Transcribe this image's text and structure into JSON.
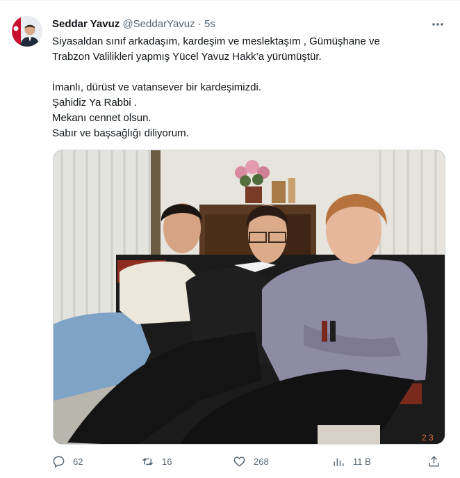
{
  "author": {
    "name": "Seddar Yavuz",
    "handle": "@SeddarYavuz",
    "separator": "·",
    "time": "5s"
  },
  "tweet": {
    "lines": [
      "Siyasaldan sınıf arkadaşım, kardeşim ve meslektaşım , Gümüşhane ve",
      "Trabzon Valilikleri yapmış Yücel Yavuz Hakk’a yürümüştür.",
      "İmanlı, dürüst ve vatansever bir kardeşimizdi.",
      "Şahidiz Ya Rabbi .",
      "Mekanı cennet olsun.",
      "Sabır ve başsağlığı diliyorum."
    ]
  },
  "media": {
    "photo_date_stamp": "2 3"
  },
  "actions": {
    "replies": "62",
    "reposts": "16",
    "likes": "268",
    "views": "11 B"
  },
  "icons": {
    "more": "more-icon",
    "reply": "reply-icon",
    "repost": "repost-icon",
    "like": "heart-icon",
    "views": "views-icon",
    "share": "share-icon"
  },
  "colors": {
    "text": "#0f1419",
    "secondary": "#536471",
    "border": "#cfd9de"
  }
}
